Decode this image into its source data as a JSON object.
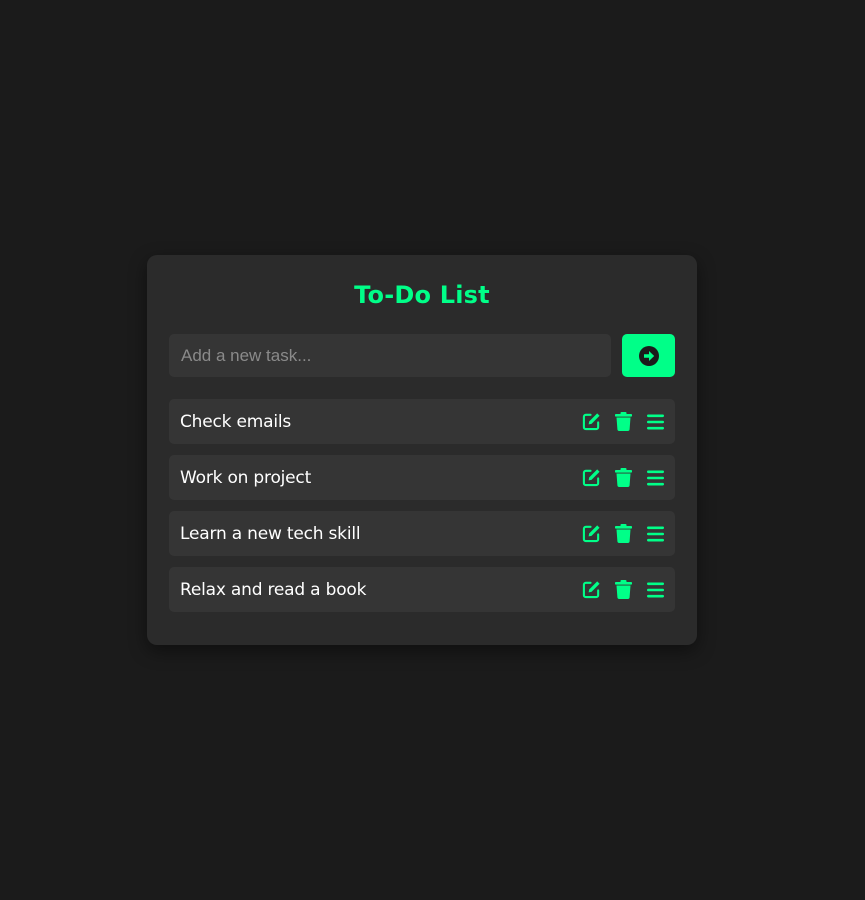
{
  "app": {
    "title": "To-Do List"
  },
  "input": {
    "placeholder": "Add a new task...",
    "value": ""
  },
  "add_button": {
    "icon": "arrow-circle-right-icon"
  },
  "tasks": [
    {
      "text": "Check emails"
    },
    {
      "text": "Work on project"
    },
    {
      "text": "Learn a new tech skill"
    },
    {
      "text": "Relax and read a book"
    }
  ],
  "task_icons": [
    "edit-icon",
    "trash-icon",
    "drag-handle-icon"
  ],
  "colors": {
    "background": "#1b1b1b",
    "card": "#2b2b2b",
    "item": "#353535",
    "accent": "#00ff88",
    "text": "#ffffff"
  }
}
